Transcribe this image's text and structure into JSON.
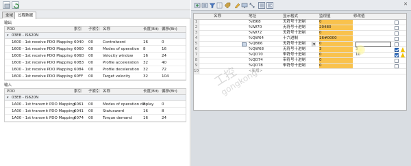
{
  "left": {
    "tabs": [
      "全域",
      "过程数据"
    ],
    "active_tab": 1,
    "output_label": "输出",
    "input_label": "输入",
    "columns": [
      "PDO",
      "索引",
      "子索引",
      "名称",
      "长度(Bit)",
      "偏移(Bit)"
    ],
    "output_group": "03E8 - IS620N",
    "outputs": [
      {
        "pdo": "1600 - 1st receive PDO Mapping",
        "index": "6040",
        "sub": "00",
        "name": "Controlword",
        "len": "16",
        "off": "0"
      },
      {
        "pdo": "1600 - 1st receive PDO Mapping",
        "index": "6060",
        "sub": "00",
        "name": "Modes of operation",
        "len": "8",
        "off": "16"
      },
      {
        "pdo": "1600 - 1st receive PDO Mapping",
        "index": "606D",
        "sub": "00",
        "name": "Velocity window",
        "len": "16",
        "off": "24"
      },
      {
        "pdo": "1600 - 1st receive PDO Mapping",
        "index": "60B3",
        "sub": "00",
        "name": "Profile acceleration",
        "len": "32",
        "off": "40"
      },
      {
        "pdo": "1600 - 1st receive PDO Mapping",
        "index": "6084",
        "sub": "00",
        "name": "Profile deceleration",
        "len": "32",
        "off": "72"
      },
      {
        "pdo": "1600 - 1st receive PDO Mapping",
        "index": "60FF",
        "sub": "00",
        "name": "Target velocity",
        "len": "32",
        "off": "104"
      }
    ],
    "input_group": "03E8 - IS620N",
    "inputs": [
      {
        "pdo": "1A00 - 1st transmit PDO Mapping",
        "index": "6061",
        "sub": "00",
        "name": "Modes of operation display",
        "len": "8",
        "off": "0"
      },
      {
        "pdo": "1A00 - 1st transmit PDO Mapping",
        "index": "6041",
        "sub": "00",
        "name": "Statusword",
        "len": "16",
        "off": "8"
      },
      {
        "pdo": "1A00 - 1st transmit PDO Mapping",
        "index": "6074",
        "sub": "00",
        "name": "Torque demand",
        "len": "16",
        "off": "24"
      }
    ]
  },
  "watch": {
    "columns": [
      "名称",
      "地址",
      "显示格式",
      "监视值",
      "修改值"
    ],
    "rows": [
      {
        "num": "1",
        "name": "",
        "addr": "%IB68",
        "fmt": "无符号十进制",
        "mon": "0",
        "mod": "",
        "chk": false,
        "warn": false
      },
      {
        "num": "2",
        "name": "",
        "addr": "%IW70",
        "fmt": "无符号十进制",
        "mon": "20480",
        "mod": "",
        "chk": false,
        "warn": false
      },
      {
        "num": "3",
        "name": "",
        "addr": "%IW72",
        "fmt": "无符号十进制",
        "mon": "0",
        "mod": "",
        "chk": false,
        "warn": false
      },
      {
        "num": "4",
        "name": "",
        "addr": "%QW64",
        "fmt": "十六进制",
        "mon": "16#0000",
        "mod": "",
        "chk": false,
        "warn": false
      },
      {
        "num": "5",
        "name": "",
        "addr": "%QB66",
        "fmt": "无符号十进制",
        "mon": "0",
        "mod": "",
        "chk": false,
        "warn": false
      },
      {
        "num": "6",
        "name": "",
        "addr": "%QW68",
        "fmt": "无符号十进制",
        "mon": "3",
        "mod": "3",
        "chk": true,
        "warn": true
      },
      {
        "num": "7",
        "name": "",
        "addr": "%QD70",
        "fmt": "带符号十进制",
        "mon": "0",
        "mod": "10",
        "chk": true,
        "warn": true
      },
      {
        "num": "8",
        "name": "",
        "addr": "%QD74",
        "fmt": "带符号十进制",
        "mon": "0",
        "mod": "",
        "chk": false,
        "warn": false
      },
      {
        "num": "9",
        "name": "",
        "addr": "%QD78",
        "fmt": "带符号十进制",
        "mon": "0",
        "mod": "",
        "chk": false,
        "warn": false
      },
      {
        "num": "10",
        "name": "",
        "addr": "<新增>",
        "fmt": "",
        "mon": "",
        "mod": "",
        "chk": false,
        "warn": false
      }
    ]
  },
  "watermark": {
    "main": "工控",
    "sub": "gongkong"
  },
  "colors": {
    "monitor": "#f9c24d",
    "check": "#2b6fc9",
    "warn": "#f2c200"
  },
  "icons": [
    "refresh-icon",
    "add-icon",
    "insert-icon",
    "filter-icon",
    "edit-icon",
    "tag-icon",
    "expand-icon",
    "hex-icon",
    "decimal-icon",
    "close-icon"
  ]
}
